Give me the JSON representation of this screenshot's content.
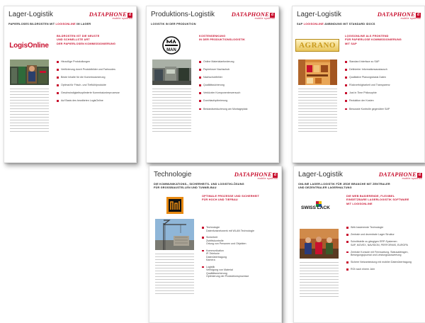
{
  "brand": {
    "name": "DATAPHONE",
    "badge": "d",
    "tagline": "mobile systems"
  },
  "colors": {
    "accent": "#c8102e",
    "bullet": "#c8102e"
  },
  "documents": [
    {
      "header_title": "Lager-Logistik",
      "subtitle_parts": [
        "Papierloses Bildrosten mit ",
        "LogisOnline",
        " im Lager"
      ],
      "logo": "LogisOnline",
      "red_text": [
        "Bildrosten ist die neuste",
        "und schnellste Art",
        "der papierlosen Kommissionierung"
      ],
      "bullets": [
        "Hinzufüge Protokollungen",
        "Verifizierung durch Produktbilder und Farbcodes",
        "Beste Inhalte für die Kommissionierung",
        "Optimal für Frisch- und Tiefkühlprodukte",
        "Geschwindigkeitsoptimierte Kommissionierprozesse",
        "Auf Basis des bewährten LogisOnline"
      ]
    },
    {
      "header_title": "Produktions-Logistik",
      "subtitle_parts": [
        "Logistik in der Produktion",
        "",
        ""
      ],
      "logo": "MAN",
      "red_text": [
        "Kostensenkung",
        "in der Produktionslogistik"
      ],
      "bullets": [
        "Online Materialanforderung",
        "Papierloser Nachschub",
        "Nachschubfehler",
        "Qualitätssicherung",
        "Verkürzter Komponentenversuch",
        "Durchlaufoptimierung",
        "Bestandsreduzierung am Montageplatz"
      ]
    },
    {
      "header_title": "Lager-Logistik",
      "subtitle_parts": [
        "SAP ",
        "LogisOnline",
        " Anbindung mit Standard IDOCs"
      ],
      "logo": "AGRANO",
      "red_text": [
        "LogisOnline als Frontend",
        "für papierlose Kommissionierung",
        "mit SAP"
      ],
      "bullets": [
        "Standard Interface zu SAP",
        "Definierter Informationsaustausch",
        "Qualitative Planungsbasis Daten",
        "Rückverfolgbarkeit und Transparenz",
        "Just in Time Philosophie",
        "Reduktion der Kosten",
        "Bewusste Kontrolle gegenüber SAP"
      ]
    },
    {
      "header_title": "Technologie",
      "subtitle_parts": [
        "Die Kommunikations-, Sicherheits- und Logistiklösung",
        "für Grossbaustellen und Tunnelbau",
        ""
      ],
      "logo": "Baustelle",
      "red_text": [
        "Optimale Prozesse und Sicherheit",
        "für Hoch und Tiefbau"
      ],
      "bullets": [
        [
          "Technologie",
          "Datenfunknetzwerk mit WLAN Technologie"
        ],
        [
          "Sicherheit",
          "Zutrittskontrolle",
          "Ortung von Personen und Objekten"
        ],
        [
          "Kommunikation",
          "IP-Telefonie",
          "Datenübertragung",
          "Kamera"
        ],
        [
          "Logistik",
          "Verfolgung von Material",
          "Qualitätssicherung",
          "Optimierung der Produktionsprozesse"
        ]
      ]
    },
    {
      "header_title": "Lager-Logistik",
      "subtitle_parts": [
        "Online Lager-Logistik für jede Branche mit zentraler",
        "und dezentraler Lagerhaltung",
        ""
      ],
      "logo": "SWISS LACK",
      "red_text": [
        "Die Web basierende, flexibel",
        "einsetzbare Lagerlogistik Software",
        "mit LogisOnline"
      ],
      "bullets": [
        [
          "Web basierende Technologie"
        ],
        [
          "Zentrale und dezentrale Lager Struktur"
        ],
        [
          "Schnittstelle zu gängigen ERP-Systemen",
          "SAP, MOVEX, NAVISION, PERFORMIS, EUROPA"
        ],
        [
          "Zentrale Konsole mit Fernwartung, Statusabfragen, Bewegungsjournal und Leistungsauswertung"
        ],
        [
          "Sichere Netzanbindung mit mobiler Datenübertragung"
        ],
        [
          "ROI nach einem Jahr"
        ]
      ]
    }
  ]
}
